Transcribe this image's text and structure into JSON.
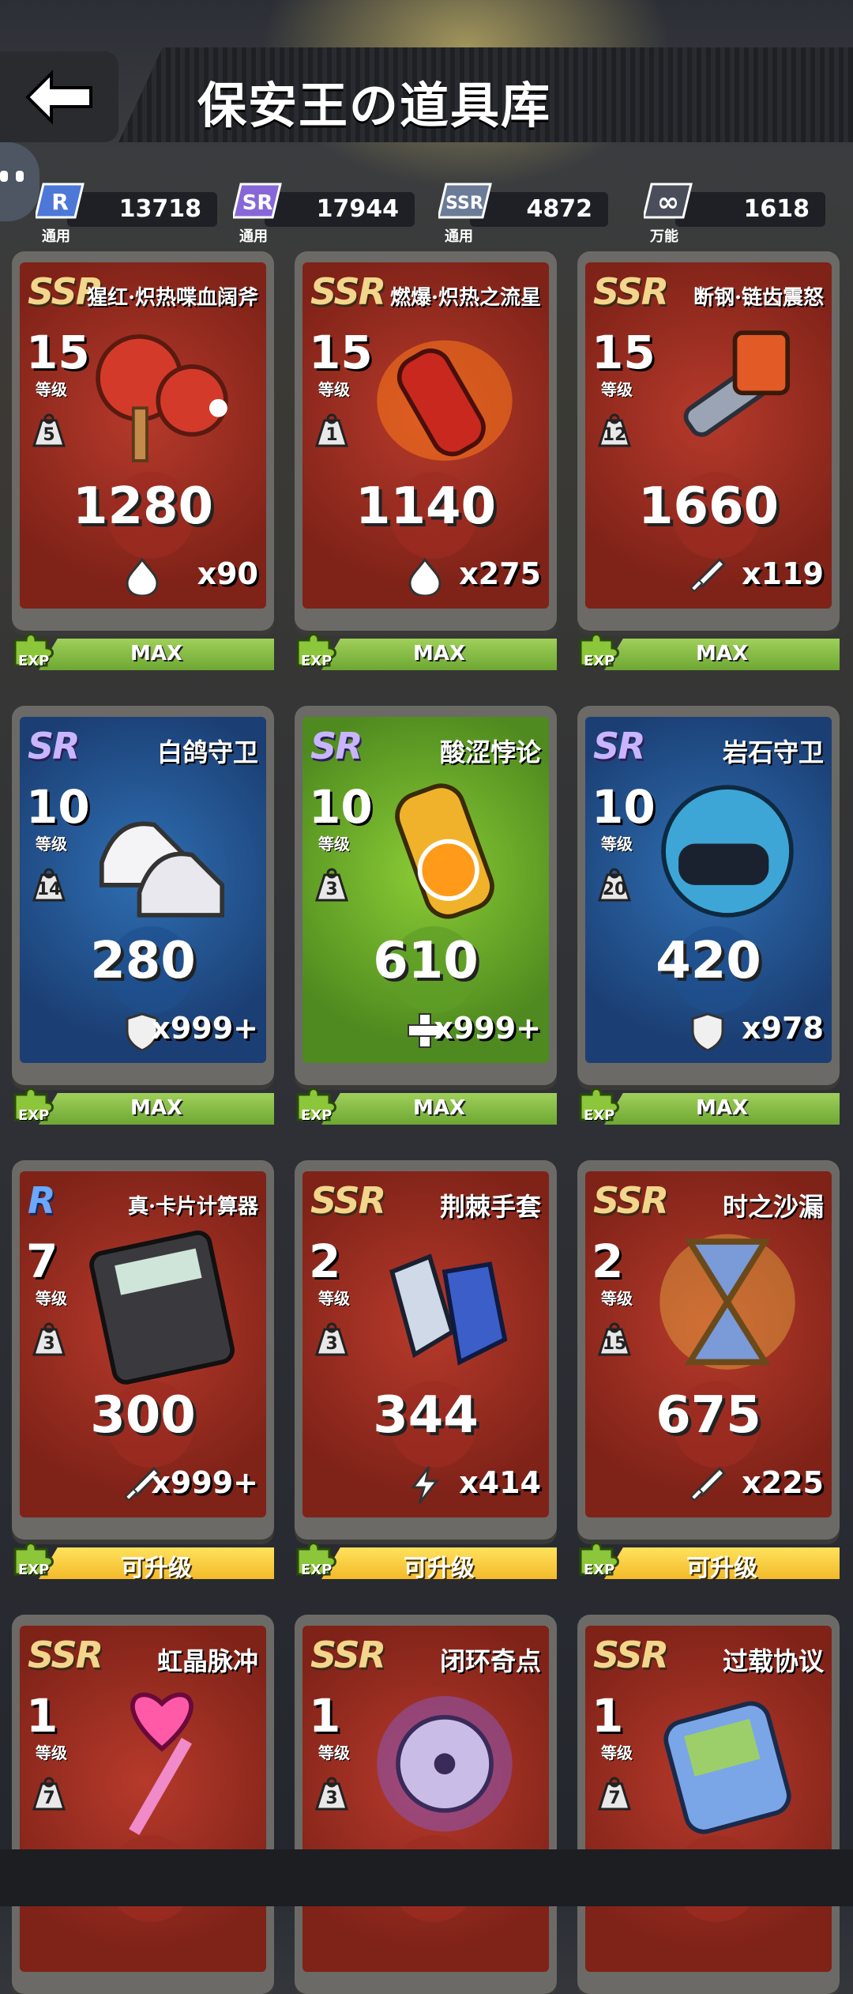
{
  "header": {
    "title": "保安王の道具库"
  },
  "currencies": [
    {
      "badge": "R",
      "sub": "通用",
      "value": "13718",
      "color": "#5a8ff0"
    },
    {
      "badge": "SR",
      "sub": "通用",
      "value": "17944",
      "color": "#9b7df0"
    },
    {
      "badge": "SSR",
      "sub": "通用",
      "value": "4872",
      "color": "#7e8fa8"
    },
    {
      "badge": "∞",
      "sub": "万能",
      "value": "1618",
      "color": "#c9c9d6"
    }
  ],
  "cards": [
    {
      "rarity": "SSR",
      "name": "猩红·炽热喋血阔斧",
      "level": "15",
      "level_label": "等级",
      "weight": "5",
      "power": "1280",
      "stat": "fire",
      "count": "x90",
      "theme": "red",
      "art": "paddles"
    },
    {
      "rarity": "SSR",
      "name": "燃爆·炽热之流星",
      "level": "15",
      "level_label": "等级",
      "weight": "1",
      "power": "1140",
      "stat": "fire",
      "count": "x275",
      "theme": "red",
      "art": "bottle"
    },
    {
      "rarity": "SSR",
      "name": "断钢·链齿震怒",
      "level": "15",
      "level_label": "等级",
      "weight": "12",
      "power": "1660",
      "stat": "sword",
      "count": "x119",
      "theme": "red",
      "art": "chainsaw"
    },
    {
      "rarity": "SR",
      "name": "白鸽守卫",
      "level": "10",
      "level_label": "等级",
      "weight": "14",
      "power": "280",
      "stat": "shield",
      "count": "x999+",
      "theme": "blue",
      "art": "shoes"
    },
    {
      "rarity": "SR",
      "name": "酸涩悖论",
      "level": "10",
      "level_label": "等级",
      "weight": "3",
      "power": "610",
      "stat": "plus",
      "count": "x999+",
      "theme": "green",
      "art": "can"
    },
    {
      "rarity": "SR",
      "name": "岩石守卫",
      "level": "10",
      "level_label": "等级",
      "weight": "20",
      "power": "420",
      "stat": "shield",
      "count": "x978",
      "theme": "blue",
      "art": "helmet"
    },
    {
      "rarity": "R",
      "name": "真·卡片计算器",
      "level": "7",
      "level_label": "等级",
      "weight": "3",
      "power": "300",
      "stat": "sword",
      "count": "x999+",
      "theme": "red",
      "art": "calculator"
    },
    {
      "rarity": "SSR",
      "name": "荆棘手套",
      "level": "2",
      "level_label": "等级",
      "weight": "3",
      "power": "344",
      "stat": "bolt",
      "count": "x414",
      "theme": "red",
      "art": "gloves"
    },
    {
      "rarity": "SSR",
      "name": "时之沙漏",
      "level": "2",
      "level_label": "等级",
      "weight": "15",
      "power": "675",
      "stat": "sword",
      "count": "x225",
      "theme": "red",
      "art": "hourglass"
    },
    {
      "rarity": "SSR",
      "name": "虹晶脉冲",
      "level": "1",
      "level_label": "等级",
      "weight": "7",
      "power": "",
      "stat": "",
      "count": "",
      "theme": "red",
      "art": "wand"
    },
    {
      "rarity": "SSR",
      "name": "闭环奇点",
      "level": "1",
      "level_label": "等级",
      "weight": "3",
      "power": "",
      "stat": "",
      "count": "",
      "theme": "red",
      "art": "disc"
    },
    {
      "rarity": "SSR",
      "name": "过载协议",
      "level": "1",
      "level_label": "等级",
      "weight": "7",
      "power": "",
      "stat": "",
      "count": "",
      "theme": "red",
      "art": "gamepad"
    }
  ],
  "exp_bars": [
    {
      "label": "MAX",
      "exp": "EXP",
      "state": "max"
    },
    {
      "label": "MAX",
      "exp": "EXP",
      "state": "max"
    },
    {
      "label": "MAX",
      "exp": "EXP",
      "state": "max"
    },
    {
      "label": "MAX",
      "exp": "EXP",
      "state": "max"
    },
    {
      "label": "MAX",
      "exp": "EXP",
      "state": "max"
    },
    {
      "label": "MAX",
      "exp": "EXP",
      "state": "max"
    },
    {
      "label": "可升级",
      "exp": "EXP",
      "state": "up"
    },
    {
      "label": "可升级",
      "exp": "EXP",
      "state": "up"
    },
    {
      "label": "可升级",
      "exp": "EXP",
      "state": "up"
    }
  ]
}
